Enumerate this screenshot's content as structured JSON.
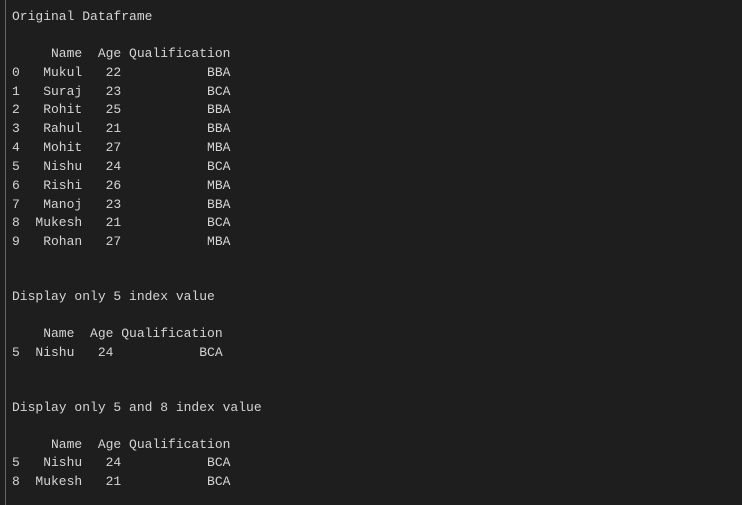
{
  "section1": {
    "title": "Original Dataframe",
    "headers": {
      "idx": "",
      "name": "Name",
      "age": "Age",
      "qual": "Qualification"
    },
    "rows": [
      {
        "idx": "0",
        "name": "Mukul",
        "age": "22",
        "qual": "BBA"
      },
      {
        "idx": "1",
        "name": "Suraj",
        "age": "23",
        "qual": "BCA"
      },
      {
        "idx": "2",
        "name": "Rohit",
        "age": "25",
        "qual": "BBA"
      },
      {
        "idx": "3",
        "name": "Rahul",
        "age": "21",
        "qual": "BBA"
      },
      {
        "idx": "4",
        "name": "Mohit",
        "age": "27",
        "qual": "MBA"
      },
      {
        "idx": "5",
        "name": "Nishu",
        "age": "24",
        "qual": "BCA"
      },
      {
        "idx": "6",
        "name": "Rishi",
        "age": "26",
        "qual": "MBA"
      },
      {
        "idx": "7",
        "name": "Manoj",
        "age": "23",
        "qual": "BBA"
      },
      {
        "idx": "8",
        "name": "Mukesh",
        "age": "21",
        "qual": "BCA"
      },
      {
        "idx": "9",
        "name": "Rohan",
        "age": "27",
        "qual": "MBA"
      }
    ]
  },
  "section2": {
    "title": "Display only 5 index value",
    "headers": {
      "idx": "",
      "name": "Name",
      "age": "Age",
      "qual": "Qualification"
    },
    "rows": [
      {
        "idx": "5",
        "name": "Nishu",
        "age": "24",
        "qual": "BCA"
      }
    ]
  },
  "section3": {
    "title": "Display only 5 and 8 index value",
    "headers": {
      "idx": "",
      "name": "Name",
      "age": "Age",
      "qual": "Qualification"
    },
    "rows": [
      {
        "idx": "5",
        "name": "Nishu",
        "age": "24",
        "qual": "BCA"
      },
      {
        "idx": "8",
        "name": "Mukesh",
        "age": "21",
        "qual": "BCA"
      }
    ]
  }
}
